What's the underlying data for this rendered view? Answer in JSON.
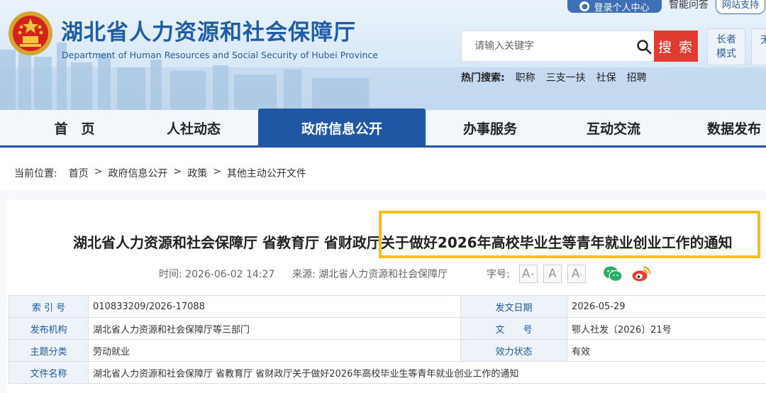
{
  "header": {
    "site_title": "湖北省人力资源和社会保障厅",
    "site_subtitle": "Department of Human Resources and Social Security of Hubei Province",
    "login_label": "登录个人中心",
    "smart_qa_label": "智能问答",
    "site_support_label": "网站支持",
    "search_placeholder": "请输入关键字",
    "search_button": "搜 索",
    "elder_mode": [
      "长者",
      "模式"
    ],
    "extra_mode": "无",
    "hot_search_label": "热门搜索:",
    "hot_search_items": [
      "职称",
      "三支一扶",
      "社保",
      "招聘"
    ]
  },
  "nav": {
    "items": [
      {
        "label": "首　页"
      },
      {
        "label": "人社动态"
      },
      {
        "label": "政府信息公开"
      },
      {
        "label": "办事服务"
      },
      {
        "label": "互动交流"
      },
      {
        "label": "数据发布"
      }
    ],
    "active_index": 2
  },
  "breadcrumb": {
    "prefix": "当前位置:",
    "items": [
      "首页",
      "政府信息公开",
      "政策",
      "其他主动公开文件"
    ],
    "separator": ">"
  },
  "article": {
    "title": "湖北省人力资源和社会保障厅 省教育厅 省财政厅关于做好2026年高校毕业生等青年就业创业工作的通知",
    "time_label": "时间:",
    "time": "2026-06-02 14:27",
    "source_label": "来源:",
    "source": "湖北省人力资源和社会保障厅",
    "font_size_label": "字号:",
    "font_buttons": [
      "A",
      "A",
      "A"
    ]
  },
  "info_table": {
    "rows": [
      {
        "label1": "索 引 号",
        "value1": "010833209/2026-17088",
        "label2": "发文日期",
        "value2": "2026-05-29"
      },
      {
        "label1": "发布机构",
        "value1": "湖北省人力资源和社会保障厅等三部门",
        "label2": "文　　号",
        "value2": "鄂人社发〔2026〕21号"
      },
      {
        "label1": "主题分类",
        "value1": "劳动就业",
        "label2": "效力状态",
        "value2": "有效"
      },
      {
        "label1": "文件名称",
        "value1": "湖北省人力资源和社会保障厅 省教育厅 省财政厅关于做好2026年高校毕业生等青年就业创业工作的通知",
        "label2": "",
        "value2": ""
      }
    ]
  },
  "colors": {
    "brand_blue": "#2057a4",
    "search_red": "#e03b31",
    "highlight_yellow": "#f5bf1d",
    "wechat_green": "#2aae67",
    "weibo_orange": "#f5a623"
  }
}
